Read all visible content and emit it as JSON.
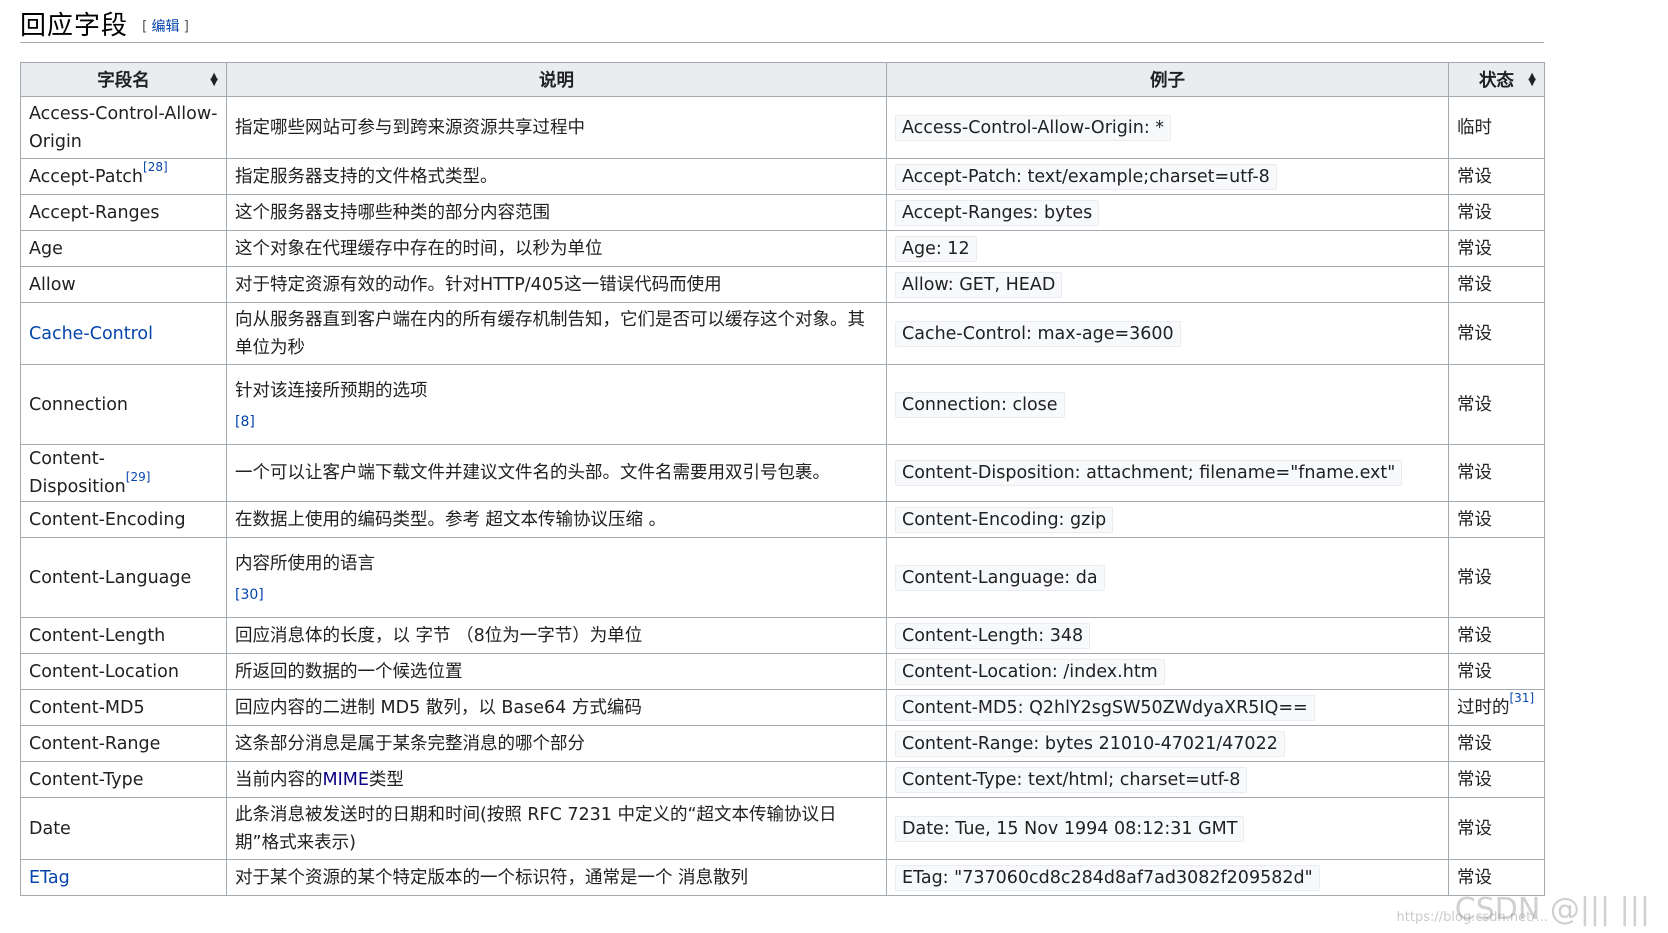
{
  "section": {
    "title": "回应字段",
    "edit_open": "[",
    "edit_label": "编辑",
    "edit_close": "]"
  },
  "table": {
    "headers": [
      "字段名",
      "说明",
      "例子",
      "状态"
    ],
    "rows": [
      {
        "name": "Access-Control-Allow-Origin",
        "desc": "指定哪些网站可参与到跨来源资源共享过程中",
        "example": "Access-Control-Allow-Origin: *",
        "status": "临时"
      },
      {
        "name": "Accept-Patch",
        "name_sup": "[28]",
        "desc": "指定服务器支持的文件格式类型。",
        "example": "Accept-Patch: text/example;charset=utf-8",
        "status": "常设"
      },
      {
        "name": "Accept-Ranges",
        "desc": "这个服务器支持哪些种类的部分内容范围",
        "example": "Accept-Ranges: bytes",
        "status": "常设"
      },
      {
        "name": "Age",
        "desc": "这个对象在代理缓存中存在的时间，以秒为单位",
        "example": "Age: 12",
        "status": "常设"
      },
      {
        "name": "Allow",
        "desc": "对于特定资源有效的动作。针对HTTP/405这一错误代码而使用",
        "example": "Allow: GET, HEAD",
        "status": "常设"
      },
      {
        "name": "Cache-Control",
        "name_link": true,
        "desc": "向从服务器直到客户端在内的所有缓存机制告知，它们是否可以缓存这个对象。其单位为秒",
        "example": "Cache-Control: max-age=3600",
        "status": "常设"
      },
      {
        "name": "Connection",
        "desc": "针对该连接所预期的选项",
        "desc_ref": "[8]",
        "example": "Connection: close",
        "status": "常设"
      },
      {
        "name": "Content-Disposition",
        "name_sup": "[29]",
        "desc": "一个可以让客户端下载文件并建议文件名的头部。文件名需要用双引号包裹。",
        "example": "Content-Disposition: attachment; filename=\"fname.ext\"",
        "status": "常设"
      },
      {
        "name": "Content-Encoding",
        "desc": "在数据上使用的编码类型。参考 超文本传输协议压缩 。",
        "example": "Content-Encoding: gzip",
        "status": "常设"
      },
      {
        "name": "Content-Language",
        "desc": "内容所使用的语言",
        "desc_ref": "[30]",
        "example": "Content-Language: da",
        "status": "常设"
      },
      {
        "name": "Content-Length",
        "desc": "回应消息体的长度，以 字节 （8位为一字节）为单位",
        "example": "Content-Length: 348",
        "status": "常设"
      },
      {
        "name": "Content-Location",
        "desc": "所返回的数据的一个候选位置",
        "example": "Content-Location: /index.htm",
        "status": "常设"
      },
      {
        "name": "Content-MD5",
        "desc": "回应内容的二进制 MD5 散列，以 Base64 方式编码",
        "example": "Content-MD5: Q2hlY2sgSW50ZWdyaXR5IQ==",
        "status": "过时的",
        "status_sup": "[31]"
      },
      {
        "name": "Content-Range",
        "desc": "这条部分消息是属于某条完整消息的哪个部分",
        "example": "Content-Range: bytes 21010-47021/47022",
        "status": "常设"
      },
      {
        "name": "Content-Type",
        "desc_pre": "当前内容的",
        "desc_link": "MIME",
        "desc_post": "类型",
        "example": "Content-Type: text/html; charset=utf-8",
        "status": "常设"
      },
      {
        "name": "Date",
        "desc": "此条消息被发送时的日期和时间(按照 RFC 7231 中定义的“超文本传输协议日期”格式来表示)",
        "example": "Date: Tue, 15 Nov 1994 08:12:31 GMT",
        "status": "常设"
      },
      {
        "name": "ETag",
        "name_link": true,
        "desc": "对于某个资源的某个特定版本的一个标识符，通常是一个 消息散列",
        "example": "ETag: \"737060cd8c284d8af7ad3082f209582d\"",
        "status": "常设"
      }
    ]
  },
  "watermark": {
    "text": "CSDN @|||  |||",
    "url": "https://blog.csdn.net/..."
  }
}
